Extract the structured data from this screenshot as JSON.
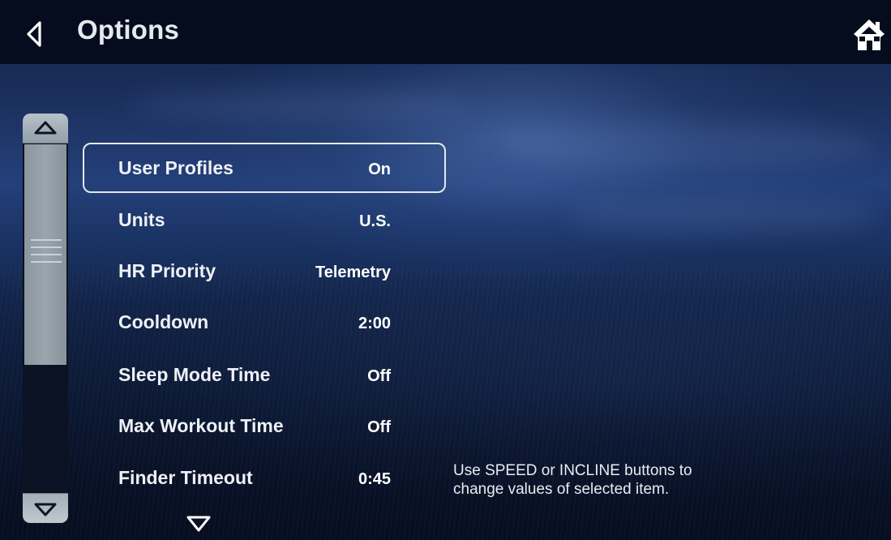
{
  "header": {
    "title": "Options",
    "back_icon": "back-triangle-icon",
    "home_icon": "home-icon"
  },
  "scrollbar": {
    "up_icon": "chevron-up-icon",
    "down_icon": "chevron-down-icon",
    "grip_icon": "grip-lines-icon"
  },
  "options": [
    {
      "label": "User Profiles",
      "value": "On",
      "selected": true
    },
    {
      "label": "Units",
      "value": "U.S.",
      "selected": false
    },
    {
      "label": "HR Priority",
      "value": "Telemetry",
      "selected": false
    },
    {
      "label": "Cooldown",
      "value": "2:00",
      "selected": false
    },
    {
      "label": "Sleep Mode Time",
      "value": "Off",
      "selected": false
    },
    {
      "label": "Max Workout Time",
      "value": "Off",
      "selected": false
    },
    {
      "label": "Finder Timeout",
      "value": "0:45",
      "selected": false
    }
  ],
  "more_icon": "more-down-arrow-icon",
  "hint": {
    "line1": "Use SPEED or INCLINE buttons to",
    "line2": "change values of selected item."
  },
  "colors": {
    "header_bg": "#050c1d",
    "text": "#eef1f5",
    "selection_border": "#e4e8ee",
    "scrollbar": "#9aa5ae"
  }
}
